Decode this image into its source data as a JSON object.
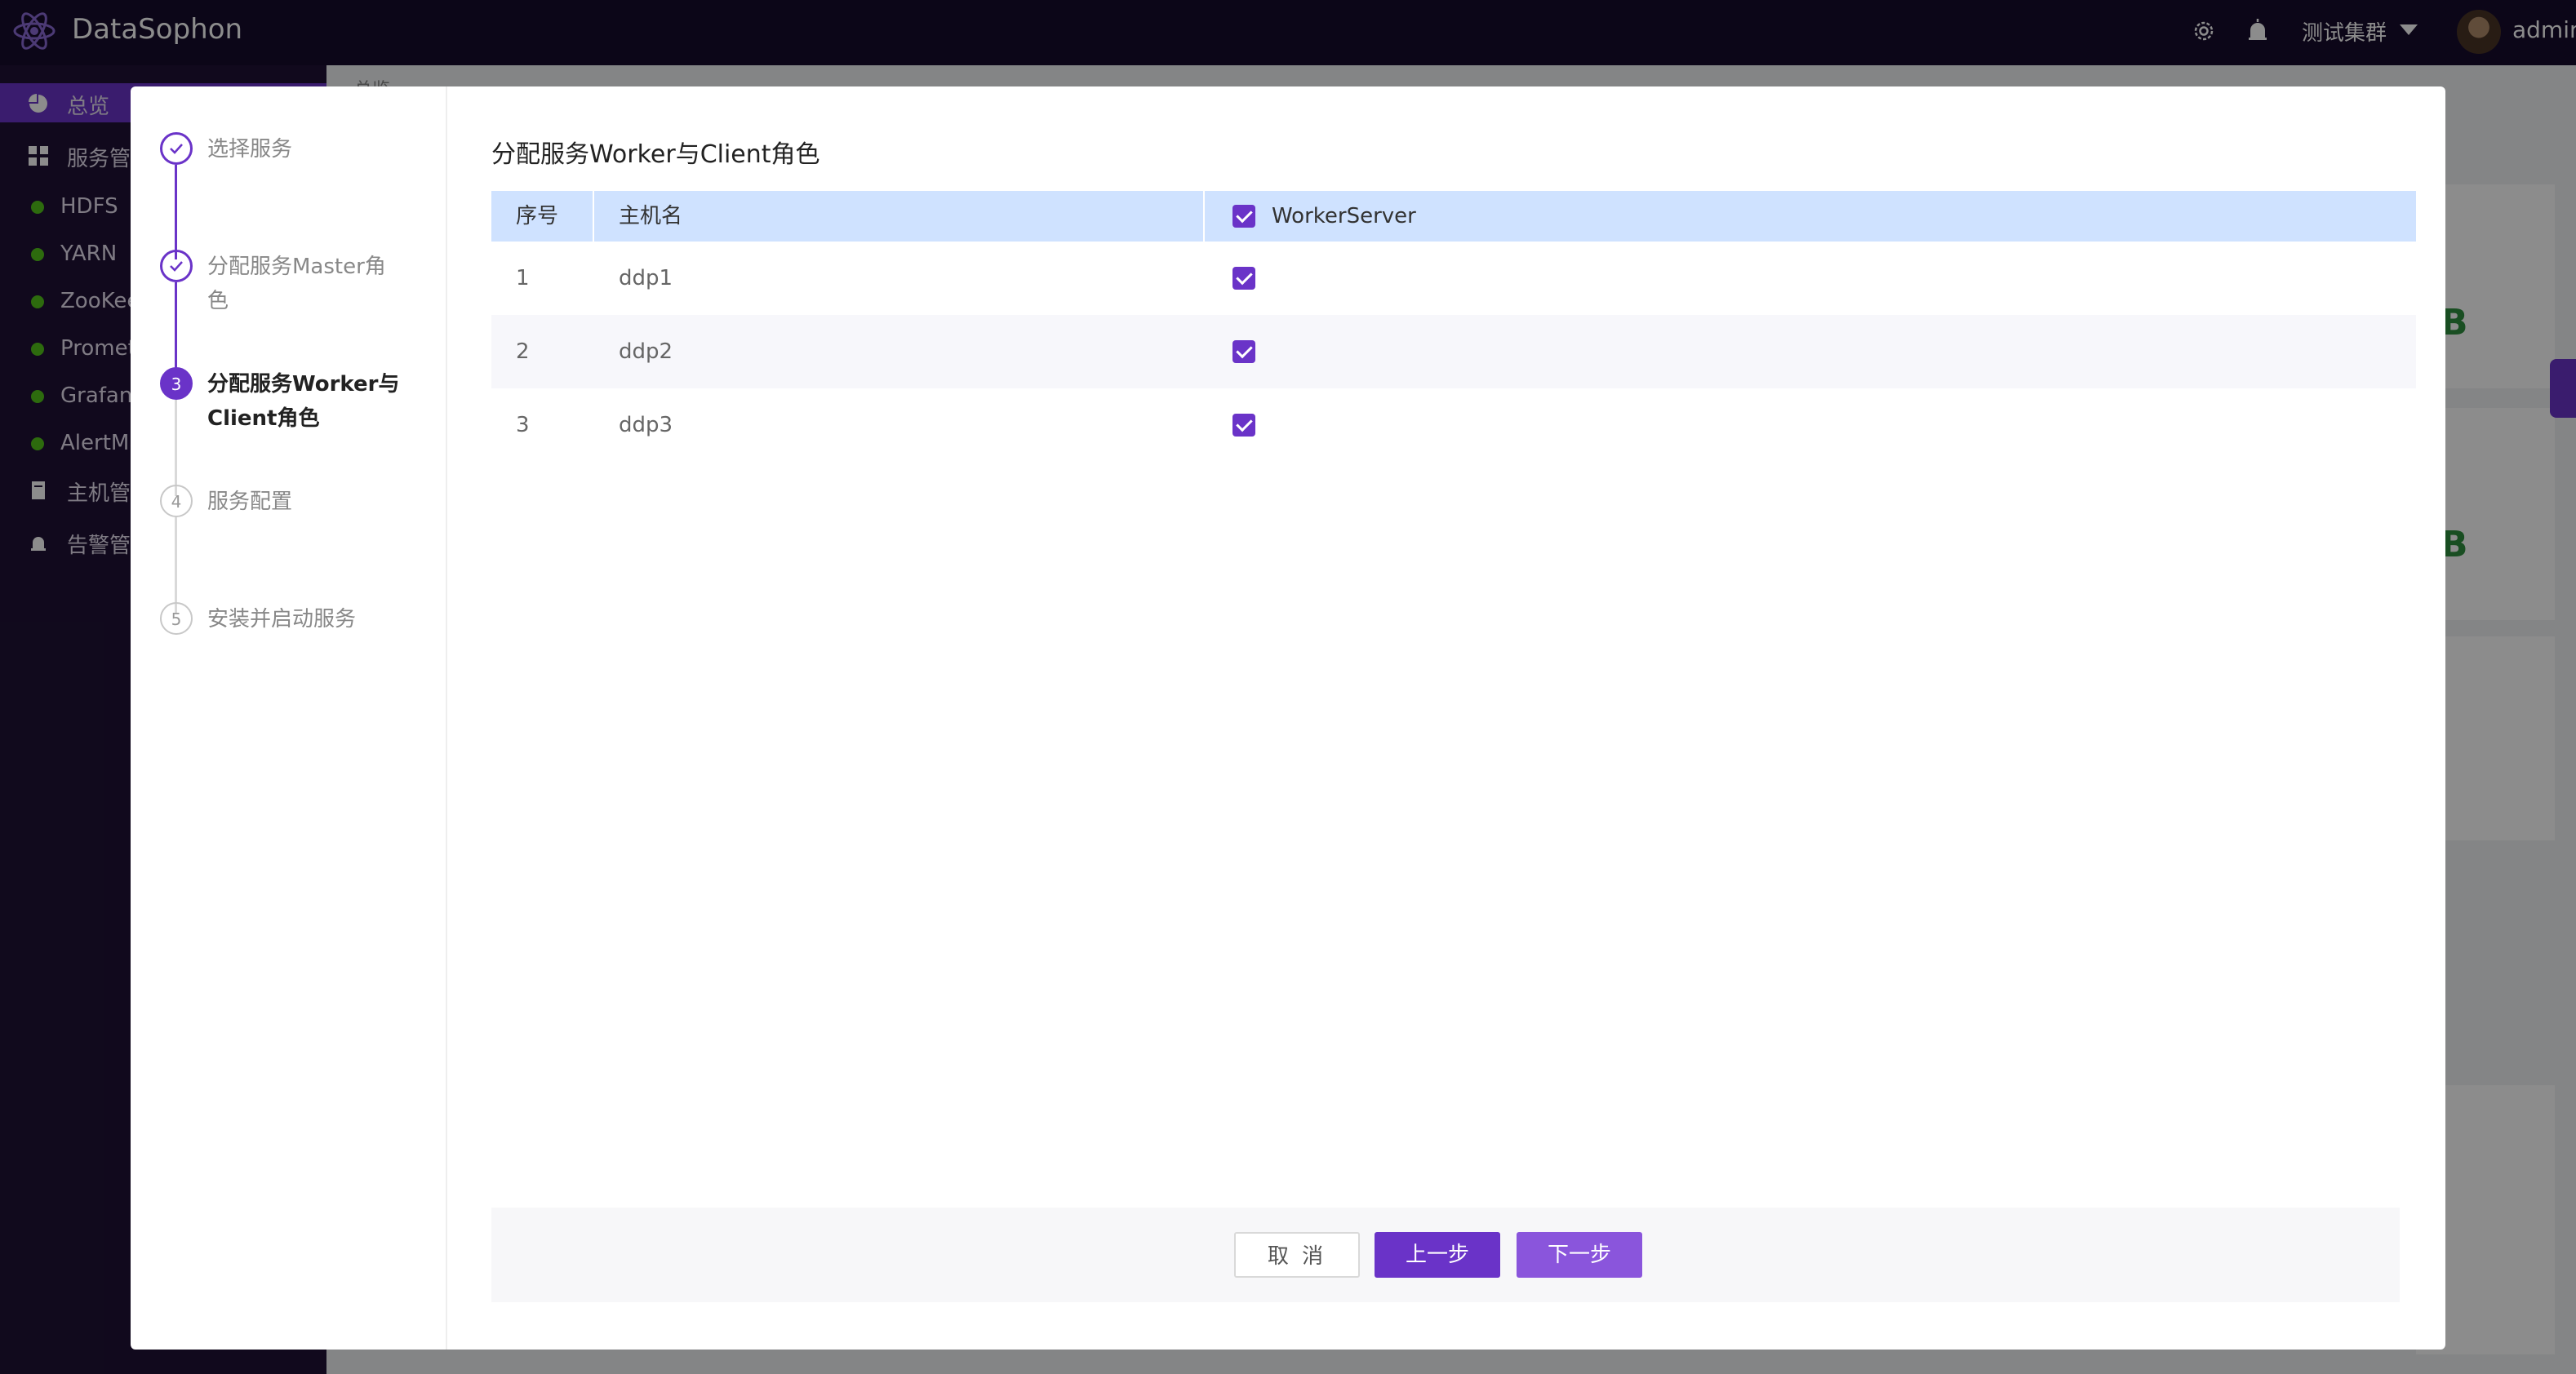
{
  "header": {
    "brand": "DataSophon",
    "cluster_name": "测试集群",
    "username": "admin",
    "icons": [
      "settings-icon",
      "alarm-icon",
      "chevron-down-icon"
    ]
  },
  "sidebar": {
    "items": [
      {
        "label": "总览",
        "icon": "pie-chart-icon",
        "active": true
      },
      {
        "label": "服务管理",
        "icon": "grid-icon"
      },
      {
        "label": "主机管理",
        "icon": "server-icon"
      },
      {
        "label": "告警管理",
        "icon": "alarm-icon"
      }
    ],
    "services": [
      "HDFS",
      "YARN",
      "ZooKeeper",
      "Prometheus",
      "Grafana",
      "AlertManager"
    ],
    "service_status_color": "#52c41a"
  },
  "main": {
    "breadcrumb": "总览",
    "card_values": [
      "B",
      "B"
    ]
  },
  "modal": {
    "steps": [
      {
        "number": "1",
        "label": "选择服务",
        "status": "done"
      },
      {
        "number": "2",
        "label": "分配服务Master角色",
        "status": "done"
      },
      {
        "number": "3",
        "label": "分配服务Worker与Client角色",
        "status": "current"
      },
      {
        "number": "4",
        "label": "服务配置",
        "status": "todo"
      },
      {
        "number": "5",
        "label": "安装并启动服务",
        "status": "todo"
      }
    ],
    "title": "分配服务Worker与Client角色",
    "table": {
      "columns": [
        "序号",
        "主机名",
        "WorkerServer"
      ],
      "header_checked": true,
      "rows": [
        {
          "index": "1",
          "host": "ddp1",
          "checked": true
        },
        {
          "index": "2",
          "host": "ddp2",
          "checked": true
        },
        {
          "index": "3",
          "host": "ddp3",
          "checked": true
        }
      ]
    },
    "buttons": {
      "cancel": "取 消",
      "prev": "上一步",
      "next": "下一步"
    }
  },
  "colors": {
    "accent": "#6a33c8",
    "header_bg": "#170b2c",
    "table_header_bg": "#cfe2ff"
  }
}
